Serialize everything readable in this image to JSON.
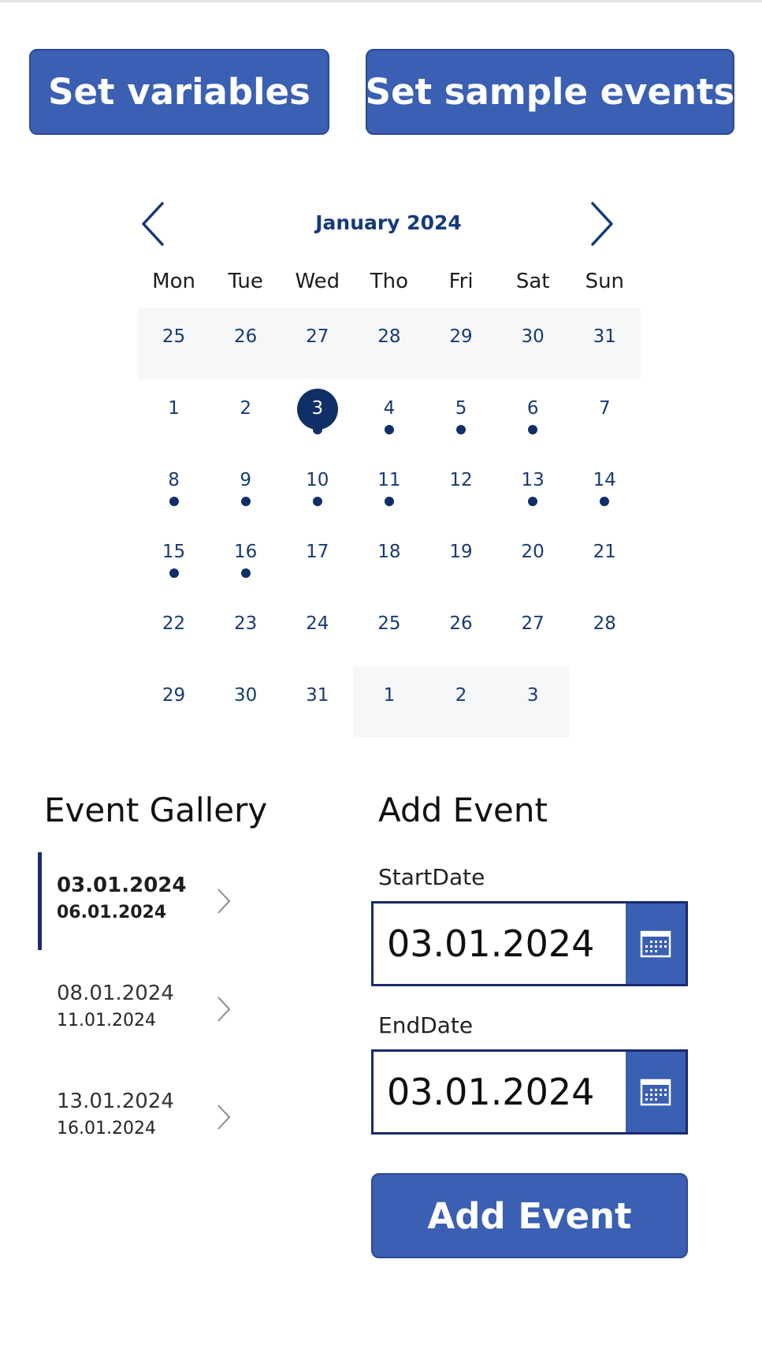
{
  "toolbar": {
    "set_variables_label": "Set variables",
    "set_sample_events_label": "Set sample events"
  },
  "calendar": {
    "month_label": "January 2024",
    "weekdays": [
      "Mon",
      "Tue",
      "Wed",
      "Tho",
      "Fri",
      "Sat",
      "Sun"
    ],
    "weeks": [
      [
        {
          "d": "25",
          "outside": true
        },
        {
          "d": "26",
          "outside": true
        },
        {
          "d": "27",
          "outside": true
        },
        {
          "d": "28",
          "outside": true
        },
        {
          "d": "29",
          "outside": true
        },
        {
          "d": "30",
          "outside": true
        },
        {
          "d": "31",
          "outside": true
        }
      ],
      [
        {
          "d": "1"
        },
        {
          "d": "2"
        },
        {
          "d": "3",
          "selected": true,
          "event": true
        },
        {
          "d": "4",
          "event": true
        },
        {
          "d": "5",
          "event": true
        },
        {
          "d": "6",
          "event": true
        },
        {
          "d": "7"
        }
      ],
      [
        {
          "d": "8",
          "event": true
        },
        {
          "d": "9",
          "event": true
        },
        {
          "d": "10",
          "event": true
        },
        {
          "d": "11",
          "event": true
        },
        {
          "d": "12"
        },
        {
          "d": "13",
          "event": true
        },
        {
          "d": "14",
          "event": true
        }
      ],
      [
        {
          "d": "15",
          "event": true
        },
        {
          "d": "16",
          "event": true
        },
        {
          "d": "17"
        },
        {
          "d": "18"
        },
        {
          "d": "19"
        },
        {
          "d": "20"
        },
        {
          "d": "21"
        }
      ],
      [
        {
          "d": "22"
        },
        {
          "d": "23"
        },
        {
          "d": "24"
        },
        {
          "d": "25"
        },
        {
          "d": "26"
        },
        {
          "d": "27"
        },
        {
          "d": "28"
        }
      ],
      [
        {
          "d": "29"
        },
        {
          "d": "30"
        },
        {
          "d": "31"
        },
        {
          "d": "1",
          "outside": true
        },
        {
          "d": "2",
          "outside": true
        },
        {
          "d": "3",
          "outside": true
        },
        {
          "d": "",
          "blank": true
        }
      ]
    ]
  },
  "gallery": {
    "title": "Event Gallery",
    "items": [
      {
        "start": "03.01.2024",
        "end": "06.01.2024",
        "active": true
      },
      {
        "start": "08.01.2024",
        "end": "11.01.2024"
      },
      {
        "start": "13.01.2024",
        "end": "16.01.2024"
      }
    ]
  },
  "add_event": {
    "title": "Add Event",
    "start_label": "StartDate",
    "start_value": "03.01.2024",
    "end_label": "EndDate",
    "end_value": "03.01.2024",
    "submit_label": "Add Event"
  },
  "colors": {
    "accent": "#3a5fb3",
    "calendar_text": "#173a73",
    "selected_day": "#0f2f66",
    "outside_month_bg": "#f6f7f9"
  },
  "icons": {
    "prev_month": "chevron-left-icon",
    "next_month": "chevron-right-icon",
    "gallery_item": "chevron-right-icon",
    "date_picker": "calendar-icon"
  }
}
